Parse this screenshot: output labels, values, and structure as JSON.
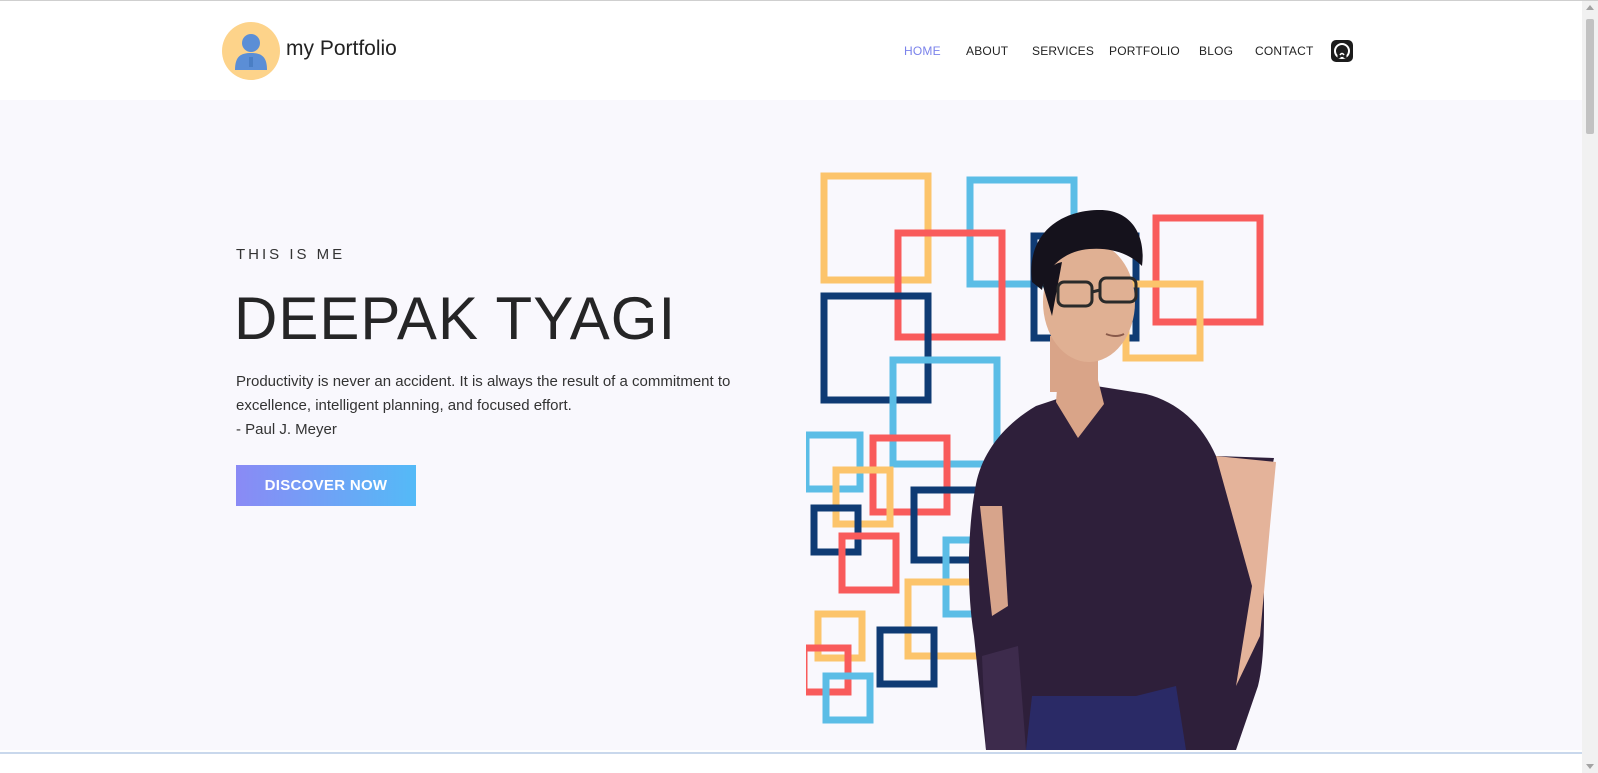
{
  "header": {
    "brand": "my Portfolio",
    "logo_icon": "user-avatar-icon",
    "nav": [
      {
        "label": "HOME",
        "active": true
      },
      {
        "label": "ABOUT",
        "active": false
      },
      {
        "label": "SERVICES",
        "active": false
      },
      {
        "label": "PORTFOLIO",
        "active": false
      },
      {
        "label": "BLOG",
        "active": false
      },
      {
        "label": "CONTACT",
        "active": false
      }
    ],
    "github_icon": "github-icon"
  },
  "hero": {
    "eyebrow": "THIS IS ME",
    "name": "DEEPAK TYAGI",
    "quote_line1": "Productivity is never an accident. It is always the result of a commitment to",
    "quote_line2": "excellence, intelligent planning, and focused effort.",
    "quote_author": "- Paul J. Meyer",
    "cta_label": "DISCOVER NOW",
    "illustration": "person-with-colorful-squares"
  },
  "colors": {
    "accent": "#7b83eb",
    "hero_bg": "#f9f8fd",
    "square_yellow": "#fcc46b",
    "square_blue": "#5bbde6",
    "square_red": "#f95b5b",
    "square_navy": "#0f3b74"
  }
}
